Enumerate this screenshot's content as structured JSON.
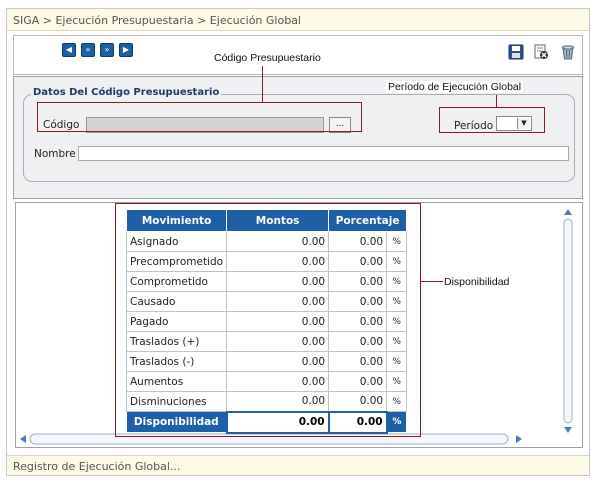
{
  "breadcrumb": "SIGA > Ejecución Presupuestaria > Ejecución Global",
  "toolbar": {
    "nav": [
      {
        "name": "first-record-button",
        "glyph": "◀"
      },
      {
        "name": "previous-record-button",
        "glyph": "«"
      },
      {
        "name": "next-record-button",
        "glyph": "»"
      },
      {
        "name": "last-record-button",
        "glyph": "▶"
      }
    ],
    "icons": [
      "save-icon",
      "cancel-icon",
      "delete-icon"
    ]
  },
  "annotations": {
    "codigo": "Código Presupuestario",
    "periodo": "Período de Ejecución Global",
    "disponibilidad": "Disponibilidad"
  },
  "datos": {
    "legend": "Datos Del Código Presupuestario",
    "codigo_label": "Código",
    "codigo_value": "",
    "browse_label": "...",
    "periodo_label": "Período",
    "periodo_value": "",
    "nombre_label": "Nombre",
    "nombre_value": ""
  },
  "grid": {
    "headers": [
      "Movimiento",
      "Montos",
      "Porcentaje"
    ],
    "pct_symbol": "%",
    "rows": [
      {
        "movimiento": "Asignado",
        "monto": "0.00",
        "porcentaje": "0.00"
      },
      {
        "movimiento": "Precomprometido",
        "monto": "0.00",
        "porcentaje": "0.00"
      },
      {
        "movimiento": "Comprometido",
        "monto": "0.00",
        "porcentaje": "0.00"
      },
      {
        "movimiento": "Causado",
        "monto": "0.00",
        "porcentaje": "0.00"
      },
      {
        "movimiento": "Pagado",
        "monto": "0.00",
        "porcentaje": "0.00"
      },
      {
        "movimiento": "Traslados (+)",
        "monto": "0.00",
        "porcentaje": "0.00"
      },
      {
        "movimiento": "Traslados (-)",
        "monto": "0.00",
        "porcentaje": "0.00"
      },
      {
        "movimiento": "Aumentos",
        "monto": "0.00",
        "porcentaje": "0.00"
      },
      {
        "movimiento": "Disminuciones",
        "monto": "0.00",
        "porcentaje": "0.00"
      }
    ],
    "total": {
      "movimiento": "Disponibilidad",
      "monto": "0.00",
      "porcentaje": "0.00"
    }
  },
  "status": "Registro de Ejecución Global...",
  "colors": {
    "header_blue": "#1f5fa8",
    "annotation_red": "#8b1a1a",
    "status_bg": "#fdfbe6"
  }
}
